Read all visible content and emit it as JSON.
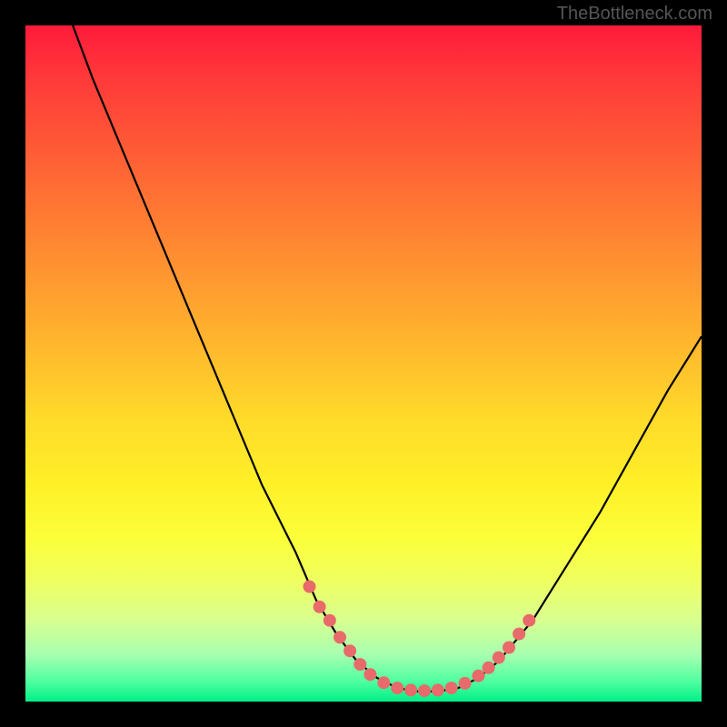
{
  "watermark": "TheBottleneck.com",
  "chart_data": {
    "type": "line",
    "title": "",
    "xlabel": "",
    "ylabel": "",
    "xlim": [
      0,
      100
    ],
    "ylim": [
      0,
      100
    ],
    "curve": [
      {
        "x": 7,
        "y": 100
      },
      {
        "x": 10,
        "y": 92
      },
      {
        "x": 15,
        "y": 80
      },
      {
        "x": 20,
        "y": 68
      },
      {
        "x": 25,
        "y": 56
      },
      {
        "x": 30,
        "y": 44
      },
      {
        "x": 35,
        "y": 32
      },
      {
        "x": 40,
        "y": 22
      },
      {
        "x": 43,
        "y": 15
      },
      {
        "x": 46,
        "y": 10
      },
      {
        "x": 49,
        "y": 6
      },
      {
        "x": 52,
        "y": 3.5
      },
      {
        "x": 55,
        "y": 2
      },
      {
        "x": 58,
        "y": 1.5
      },
      {
        "x": 61,
        "y": 1.5
      },
      {
        "x": 64,
        "y": 2
      },
      {
        "x": 67,
        "y": 3.5
      },
      {
        "x": 70,
        "y": 6
      },
      {
        "x": 75,
        "y": 12
      },
      {
        "x": 80,
        "y": 20
      },
      {
        "x": 85,
        "y": 28
      },
      {
        "x": 90,
        "y": 37
      },
      {
        "x": 95,
        "y": 46
      },
      {
        "x": 100,
        "y": 54
      }
    ],
    "markers": [
      {
        "x": 42,
        "y": 17
      },
      {
        "x": 43.5,
        "y": 14
      },
      {
        "x": 45,
        "y": 12
      },
      {
        "x": 46.5,
        "y": 9.5
      },
      {
        "x": 48,
        "y": 7.5
      },
      {
        "x": 49.5,
        "y": 5.5
      },
      {
        "x": 51,
        "y": 4
      },
      {
        "x": 53,
        "y": 2.8
      },
      {
        "x": 55,
        "y": 2
      },
      {
        "x": 57,
        "y": 1.7
      },
      {
        "x": 59,
        "y": 1.6
      },
      {
        "x": 61,
        "y": 1.7
      },
      {
        "x": 63,
        "y": 2
      },
      {
        "x": 65,
        "y": 2.7
      },
      {
        "x": 67,
        "y": 3.8
      },
      {
        "x": 68.5,
        "y": 5
      },
      {
        "x": 70,
        "y": 6.5
      },
      {
        "x": 71.5,
        "y": 8
      },
      {
        "x": 73,
        "y": 10
      },
      {
        "x": 74.5,
        "y": 12
      }
    ],
    "marker_color": "#e86a6a",
    "curve_color": "#000000"
  }
}
